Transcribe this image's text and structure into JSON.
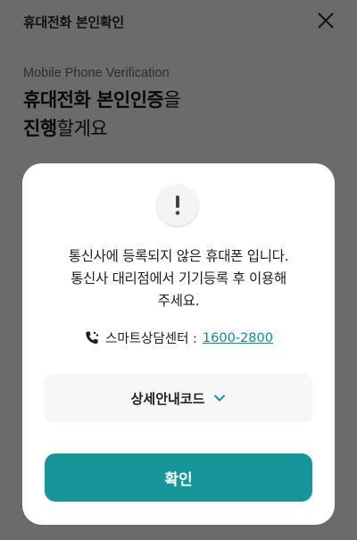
{
  "header": {
    "title": "휴대전화 본인확인",
    "close_icon": "close-icon"
  },
  "intro": {
    "subtitle": "Mobile Phone Verification",
    "headline_line1_bold": "휴대전화 본인인증",
    "headline_line1_rest": "을",
    "headline_line2_bold": "진행",
    "headline_line2_rest": "할게요"
  },
  "dialog": {
    "icon": "exclamation-icon",
    "message_lines": [
      "통신사에 등록되지 않은 휴대폰 입니다.",
      "통신사 대리점에서 기기등록 후 이용해",
      "주세요."
    ],
    "contact": {
      "icon": "phone-icon",
      "label": "스마트상담센터 :",
      "phone": "1600-2800"
    },
    "detail": {
      "label": "상세안내코드",
      "icon": "chevron-down-icon"
    },
    "confirm_label": "확인"
  },
  "colors": {
    "accent": "#17969a",
    "link": "#0e8a93",
    "backdrop": "#6b6b6b"
  }
}
